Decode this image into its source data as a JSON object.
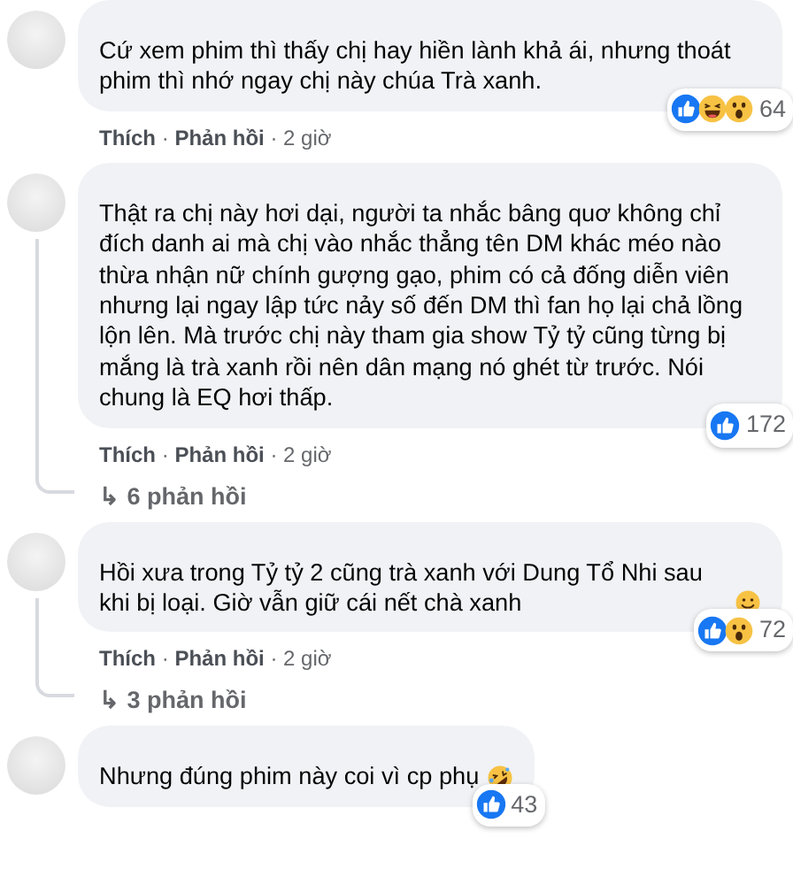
{
  "comments": [
    {
      "text": "Cứ xem phim thì thấy chị hay hiền lành khả ái, nhưng thoát phim thì nhớ ngay chị này chúa Trà xanh.",
      "reactions": [
        {
          "kind": "like"
        },
        {
          "kind": "haha"
        },
        {
          "kind": "wow"
        }
      ],
      "count": "64",
      "actions": {
        "like": "Thích",
        "sep": "·",
        "reply": "Phản hồi",
        "time": "2 giờ"
      }
    },
    {
      "text": "Thật ra chị này hơi dại, người ta nhắc bâng quơ không chỉ đích danh ai mà chị vào nhắc thẳng tên DM khác méo nào thừa nhận nữ chính gượng gạo, phim có cả đống diễn viên nhưng lại ngay lập tức nảy số đến DM thì fan họ lại chả lồng lộn lên. Mà trước chị này tham gia show Tỷ tỷ cũng từng bị mắng là trà xanh rồi nên dân mạng nó ghét từ trước. Nói chung là EQ hơi thấp.",
      "reactions": [
        {
          "kind": "like"
        }
      ],
      "count": "172",
      "actions": {
        "like": "Thích",
        "sep": "·",
        "reply": "Phản hồi",
        "time": "2 giờ"
      },
      "replies": {
        "icon": "↳",
        "label": "6 phản hồi"
      }
    },
    {
      "text": "Hồi xưa trong Tỷ tỷ 2 cũng trà xanh với Dung Tổ Nhi sau khi bị loại. Giờ vẫn giữ cái nết chà xanh",
      "emoji": {
        "kind": "smile"
      },
      "reactions": [
        {
          "kind": "like"
        },
        {
          "kind": "wow"
        }
      ],
      "count": "72",
      "actions": {
        "like": "Thích",
        "sep": "·",
        "reply": "Phản hồi",
        "time": "2 giờ"
      },
      "replies": {
        "icon": "↳",
        "label": "3 phản hồi"
      }
    },
    {
      "text": "Nhưng đúng phim này coi vì cp phụ",
      "emoji": {
        "kind": "rofl"
      },
      "reactions": [
        {
          "kind": "like"
        }
      ],
      "count": "43"
    }
  ]
}
